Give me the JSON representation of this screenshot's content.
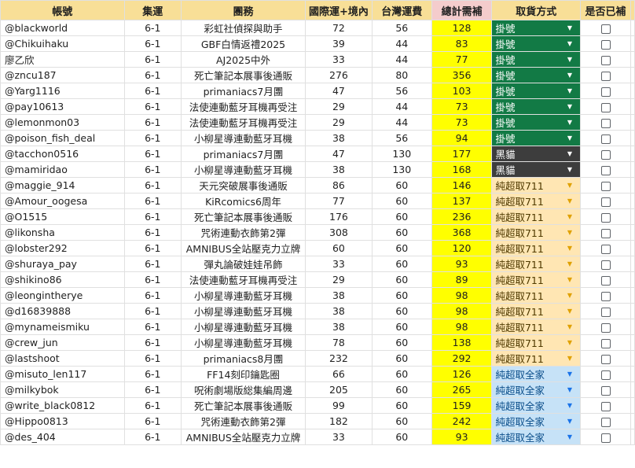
{
  "headers": {
    "account": "帳號",
    "batch": "集運",
    "group": "團務",
    "intl": "國際運+境內",
    "tw": "台灣運費",
    "total": "總計需補",
    "method": "取貨方式",
    "paid": "是否已補"
  },
  "rows": [
    {
      "account": "@blackworld",
      "batch": "6-1",
      "group": "彩虹社偵探與助手",
      "intl": "72",
      "tw": "56",
      "total": "128",
      "method": "掛號",
      "method_type": "hao"
    },
    {
      "account": "@Chikuihaku",
      "batch": "6-1",
      "group": "GBF白情返禮2025",
      "intl": "39",
      "tw": "44",
      "total": "83",
      "method": "掛號",
      "method_type": "hao"
    },
    {
      "account": "廖乙欣",
      "batch": "6-1",
      "group": "AJ2025中外",
      "intl": "33",
      "tw": "44",
      "total": "77",
      "method": "掛號",
      "method_type": "hao"
    },
    {
      "account": "@zncu187",
      "batch": "6-1",
      "group": "死亡筆記本展事後通販",
      "intl": "276",
      "tw": "80",
      "total": "356",
      "method": "掛號",
      "method_type": "hao"
    },
    {
      "account": "@Yarg1116",
      "batch": "6-1",
      "group": "primaniacs7月團",
      "intl": "47",
      "tw": "56",
      "total": "103",
      "method": "掛號",
      "method_type": "hao"
    },
    {
      "account": "@pay10613",
      "batch": "6-1",
      "group": "法使連動藍牙耳機再受注",
      "intl": "29",
      "tw": "44",
      "total": "73",
      "method": "掛號",
      "method_type": "hao"
    },
    {
      "account": "@lemonmon03",
      "batch": "6-1",
      "group": "法使連動藍牙耳機再受注",
      "intl": "29",
      "tw": "44",
      "total": "73",
      "method": "掛號",
      "method_type": "hao"
    },
    {
      "account": "@poison_fish_deal",
      "batch": "6-1",
      "group": "小柳星導連動藍牙耳機",
      "intl": "38",
      "tw": "56",
      "total": "94",
      "method": "掛號",
      "method_type": "hao"
    },
    {
      "account": "@tacchon0516",
      "batch": "6-1",
      "group": "primaniacs7月團",
      "intl": "47",
      "tw": "130",
      "total": "177",
      "method": "黑貓",
      "method_type": "black"
    },
    {
      "account": "@mamiridao",
      "batch": "6-1",
      "group": "小柳星導連動藍牙耳機",
      "intl": "38",
      "tw": "130",
      "total": "168",
      "method": "黑貓",
      "method_type": "black"
    },
    {
      "account": "@maggie_914",
      "batch": "6-1",
      "group": "天元突破展事後通販",
      "intl": "86",
      "tw": "60",
      "total": "146",
      "method": "純超取711",
      "method_type": "711"
    },
    {
      "account": "@Amour_oogesa",
      "batch": "6-1",
      "group": "KiRcomics6周年",
      "intl": "77",
      "tw": "60",
      "total": "137",
      "method": "純超取711",
      "method_type": "711"
    },
    {
      "account": "@O1515",
      "batch": "6-1",
      "group": "死亡筆記本展事後通販",
      "intl": "176",
      "tw": "60",
      "total": "236",
      "method": "純超取711",
      "method_type": "711"
    },
    {
      "account": "@likonsha",
      "batch": "6-1",
      "group": "咒術連動衣飾第2彈",
      "intl": "308",
      "tw": "60",
      "total": "368",
      "method": "純超取711",
      "method_type": "711"
    },
    {
      "account": "@lobster292",
      "batch": "6-1",
      "group": "AMNIBUS全站壓克力立牌",
      "intl": "60",
      "tw": "60",
      "total": "120",
      "method": "純超取711",
      "method_type": "711"
    },
    {
      "account": "@shuraya_pay",
      "batch": "6-1",
      "group": "彈丸論破娃娃吊飾",
      "intl": "33",
      "tw": "60",
      "total": "93",
      "method": "純超取711",
      "method_type": "711"
    },
    {
      "account": "@shikino86",
      "batch": "6-1",
      "group": "法使連動藍牙耳機再受注",
      "intl": "29",
      "tw": "60",
      "total": "89",
      "method": "純超取711",
      "method_type": "711"
    },
    {
      "account": "@leongintherye",
      "batch": "6-1",
      "group": "小柳星導連動藍牙耳機",
      "intl": "38",
      "tw": "60",
      "total": "98",
      "method": "純超取711",
      "method_type": "711"
    },
    {
      "account": "@d16839888",
      "batch": "6-1",
      "group": "小柳星導連動藍牙耳機",
      "intl": "38",
      "tw": "60",
      "total": "98",
      "method": "純超取711",
      "method_type": "711"
    },
    {
      "account": "@mynameismiku",
      "batch": "6-1",
      "group": "小柳星導連動藍牙耳機",
      "intl": "38",
      "tw": "60",
      "total": "98",
      "method": "純超取711",
      "method_type": "711"
    },
    {
      "account": "@crew_jun",
      "batch": "6-1",
      "group": "小柳星導連動藍牙耳機",
      "intl": "78",
      "tw": "60",
      "total": "138",
      "method": "純超取711",
      "method_type": "711"
    },
    {
      "account": "@lastshoot",
      "batch": "6-1",
      "group": "primaniacs8月團",
      "intl": "232",
      "tw": "60",
      "total": "292",
      "method": "純超取711",
      "method_type": "711"
    },
    {
      "account": "@misuto_len117",
      "batch": "6-1",
      "group": "FF14刻印鑰匙圈",
      "intl": "66",
      "tw": "60",
      "total": "126",
      "method": "純超取全家",
      "method_type": "fm"
    },
    {
      "account": "@milkybok",
      "batch": "6-1",
      "group": "呪術劇場版総集編周邊",
      "intl": "205",
      "tw": "60",
      "total": "265",
      "method": "純超取全家",
      "method_type": "fm"
    },
    {
      "account": "@write_black0812",
      "batch": "6-1",
      "group": "死亡筆記本展事後通販",
      "intl": "99",
      "tw": "60",
      "total": "159",
      "method": "純超取全家",
      "method_type": "fm"
    },
    {
      "account": "@Hippo0813",
      "batch": "6-1",
      "group": "咒術連動衣飾第2彈",
      "intl": "182",
      "tw": "60",
      "total": "242",
      "method": "純超取全家",
      "method_type": "fm"
    },
    {
      "account": "@des_404",
      "batch": "6-1",
      "group": "AMNIBUS全站壓克力立牌",
      "intl": "33",
      "tw": "60",
      "total": "93",
      "method": "純超取全家",
      "method_type": "fm"
    }
  ],
  "icons": {
    "dropdown": "chevron-down-icon",
    "checkbox": "checkbox-icon"
  },
  "colors": {
    "header": "#f8df97",
    "total_header": "#f4cccc",
    "total_cell": "#ffff00",
    "method_hao": "#127a45",
    "method_black": "#3d3d3d",
    "method_711": "#ffe6b3",
    "method_fm": "#c6e2f7"
  }
}
